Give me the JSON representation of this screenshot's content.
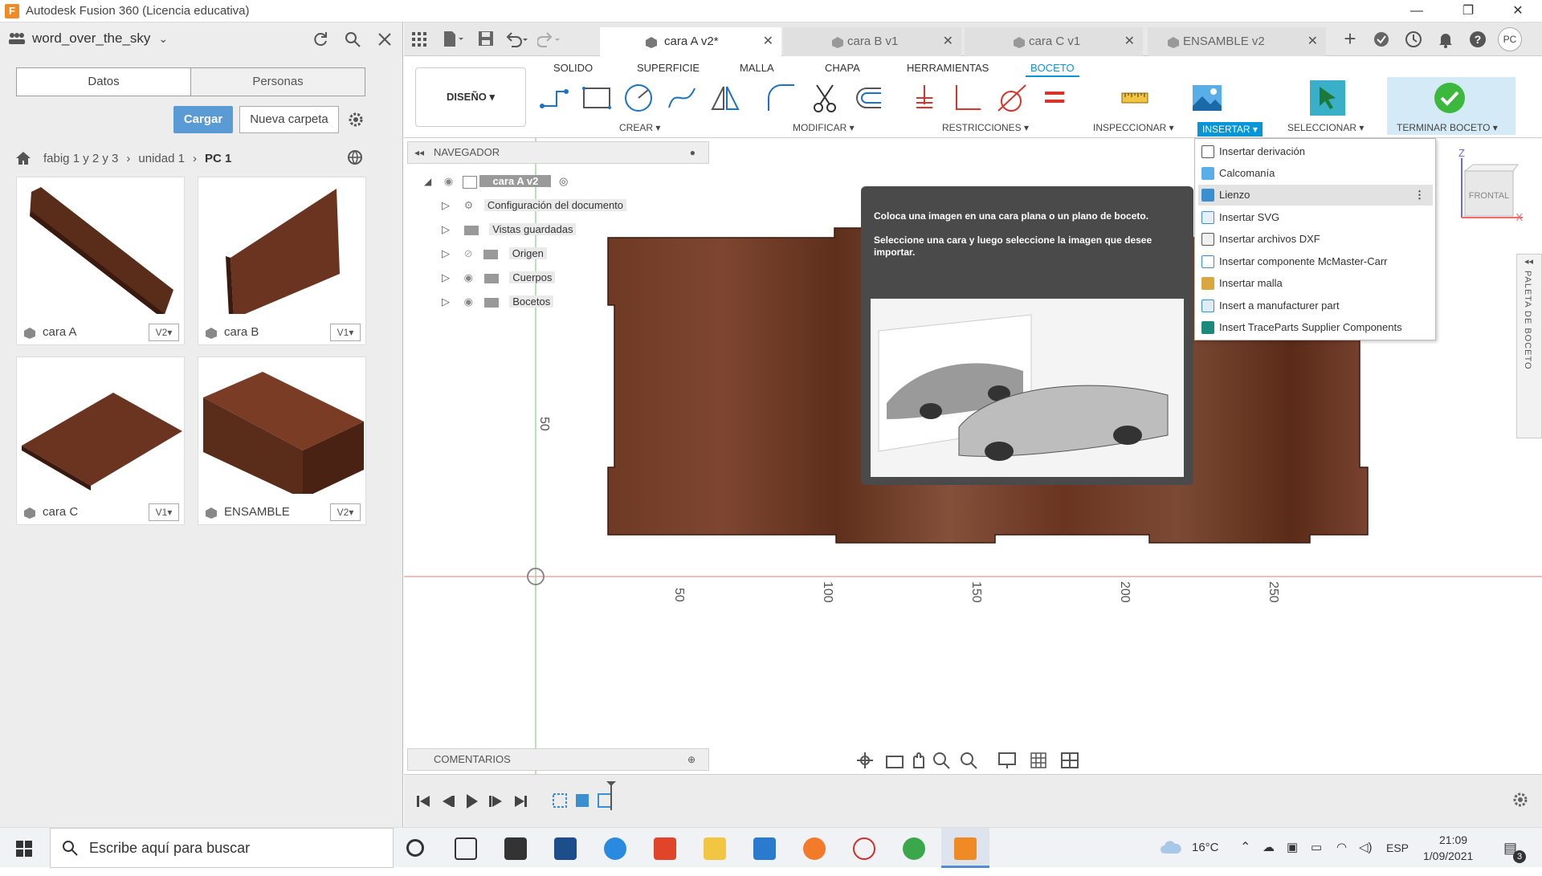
{
  "window": {
    "title": "Autodesk Fusion 360 (Licencia educativa)",
    "logo": "F",
    "min": "—",
    "restore": "❐",
    "close": "✕"
  },
  "data_panel": {
    "project": "word_over_the_sky",
    "tabs": [
      "Datos",
      "Personas"
    ],
    "upload_label": "Cargar",
    "new_folder_label": "Nueva carpeta",
    "breadcrumb": [
      "fabig 1 y 2 y 3",
      "unidad 1",
      "PC 1"
    ],
    "files": [
      {
        "name": "cara A",
        "version": "V2▾"
      },
      {
        "name": "cara B",
        "version": "V1▾"
      },
      {
        "name": "cara C",
        "version": "V1▾"
      },
      {
        "name": "ENSAMBLE",
        "version": "V2▾"
      }
    ]
  },
  "doc_tabs": [
    {
      "label": "cara A v2*",
      "close": "✕"
    },
    {
      "label": "cara B v1",
      "close": "✕"
    },
    {
      "label": "cara C v1",
      "close": "✕"
    },
    {
      "label": "ENSAMBLE v2",
      "close": "✕"
    }
  ],
  "user_initials": "PC",
  "ribbon": {
    "tabs": [
      "SOLIDO",
      "SUPERFICIE",
      "MALLA",
      "CHAPA",
      "HERRAMIENTAS",
      "BOCETO"
    ],
    "workspace": "DISEÑO ▾",
    "groups": {
      "crear": "CREAR ▾",
      "modificar": "MODIFICAR ▾",
      "restricciones": "RESTRICCIONES ▾",
      "inspeccionar": "INSPECCIONAR ▾",
      "insertar": "INSERTAR ▾",
      "seleccionar": "SELECCIONAR ▾",
      "terminar": "TERMINAR BOCETO ▾"
    }
  },
  "navigator": {
    "title": "NAVEGADOR",
    "root": "cara A v2",
    "items": [
      "Configuración del documento",
      "Vistas guardadas",
      "Origen",
      "Cuerpos",
      "Bocetos"
    ]
  },
  "ruler": {
    "vertical": "50",
    "horizontal": [
      "50",
      "100",
      "150",
      "200",
      "250"
    ]
  },
  "tooltip": {
    "line1": "Coloca una imagen en una cara plana o un plano de boceto.",
    "line2": "Seleccione una cara y luego seleccione la imagen que desee importar."
  },
  "insert_menu": [
    "Insertar derivación",
    "Calcomanía",
    "Lienzo",
    "Insertar SVG",
    "Insertar archivos DXF",
    "Insertar componente McMaster-Carr",
    "Insertar malla",
    "Insert a manufacturer part",
    "Insert TraceParts Supplier Components"
  ],
  "viewcube": {
    "label": "FRONTAL",
    "z": "Z",
    "x": "X"
  },
  "palette": "PALETA DE BOCETO",
  "comments": "COMENTARIOS",
  "taskbar": {
    "search_placeholder": "Escribe aquí para buscar",
    "temperature": "16°C",
    "language": "ESP",
    "time": "21:09",
    "date": "1/09/2021",
    "notifications": "3"
  }
}
